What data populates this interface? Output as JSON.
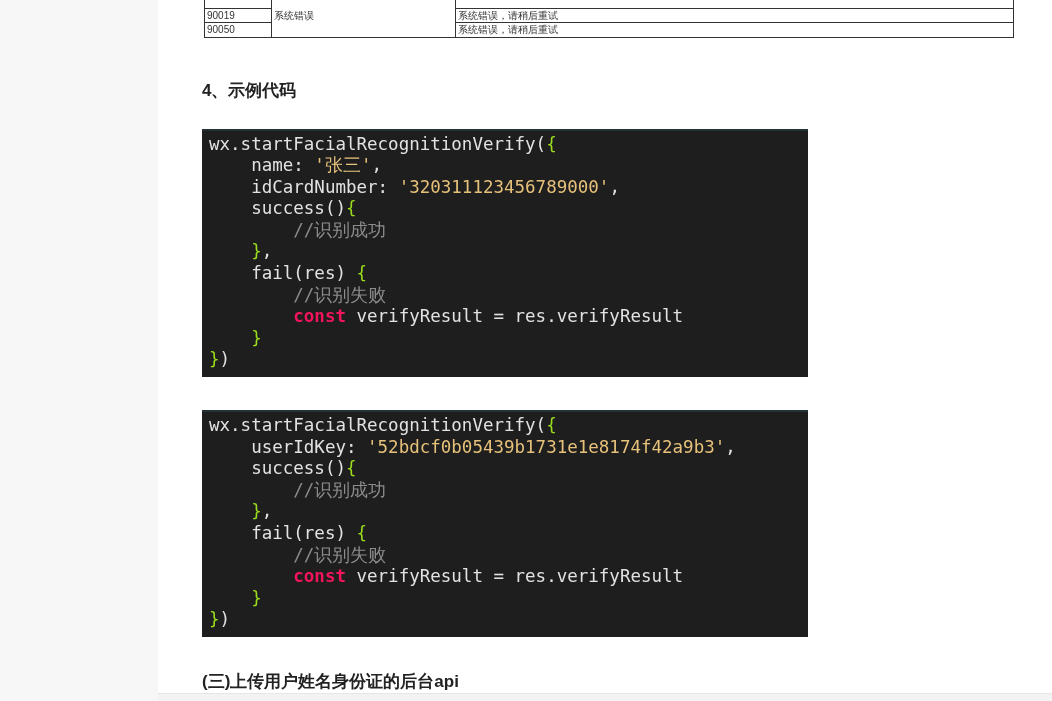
{
  "error_table": {
    "description": "系统错误",
    "rows": [
      {
        "code": "90019",
        "message": "系统错误，请稍后重试"
      },
      {
        "code": "90050",
        "message": "系统错误，请稍后重试"
      }
    ]
  },
  "section_heading": "4、示例代码",
  "code_blocks": [
    {
      "lines": [
        [
          {
            "kind": "plain",
            "text": "wx.startFacialRecognitionVerify("
          },
          {
            "kind": "brace",
            "text": "{"
          }
        ],
        [
          {
            "kind": "plain",
            "text": "    name: "
          },
          {
            "kind": "string",
            "text": "'张三'"
          },
          {
            "kind": "plain",
            "text": ","
          }
        ],
        [
          {
            "kind": "plain",
            "text": "    idCardNumber: "
          },
          {
            "kind": "string",
            "text": "'320311123456789000'"
          },
          {
            "kind": "plain",
            "text": ","
          }
        ],
        [
          {
            "kind": "plain",
            "text": "    success()"
          },
          {
            "kind": "brace",
            "text": "{"
          }
        ],
        [
          {
            "kind": "comment",
            "text": "        //识别成功"
          }
        ],
        [
          {
            "kind": "brace",
            "text": "    }"
          },
          {
            "kind": "plain",
            "text": ","
          }
        ],
        [
          {
            "kind": "plain",
            "text": "    fail(res) "
          },
          {
            "kind": "brace",
            "text": "{"
          }
        ],
        [
          {
            "kind": "comment",
            "text": "        //识别失败"
          }
        ],
        [
          {
            "kind": "keyword",
            "text": "        const"
          },
          {
            "kind": "plain",
            "text": " verifyResult = res.verifyResult"
          }
        ],
        [
          {
            "kind": "brace",
            "text": "    }"
          }
        ],
        [
          {
            "kind": "brace",
            "text": "}"
          },
          {
            "kind": "plain",
            "text": ")"
          }
        ]
      ]
    },
    {
      "lines": [
        [
          {
            "kind": "plain",
            "text": "wx.startFacialRecognitionVerify("
          },
          {
            "kind": "brace",
            "text": "{"
          }
        ],
        [
          {
            "kind": "plain",
            "text": "    userIdKey: "
          },
          {
            "kind": "string",
            "text": "'52bdcf0b05439b1731e1e8174f42a9b3'"
          },
          {
            "kind": "plain",
            "text": ","
          }
        ],
        [
          {
            "kind": "plain",
            "text": "    success()"
          },
          {
            "kind": "brace",
            "text": "{"
          }
        ],
        [
          {
            "kind": "comment",
            "text": "        //识别成功"
          }
        ],
        [
          {
            "kind": "brace",
            "text": "    }"
          },
          {
            "kind": "plain",
            "text": ","
          }
        ],
        [
          {
            "kind": "plain",
            "text": "    fail(res) "
          },
          {
            "kind": "brace",
            "text": "{"
          }
        ],
        [
          {
            "kind": "comment",
            "text": "        //识别失败"
          }
        ],
        [
          {
            "kind": "keyword",
            "text": "        const"
          },
          {
            "kind": "plain",
            "text": " verifyResult = res.verifyResult"
          }
        ],
        [
          {
            "kind": "brace",
            "text": "    }"
          }
        ],
        [
          {
            "kind": "brace",
            "text": "}"
          },
          {
            "kind": "plain",
            "text": ")"
          }
        ]
      ]
    }
  ],
  "subsection_heading": "(三)上传用户姓名身份证的后台api"
}
